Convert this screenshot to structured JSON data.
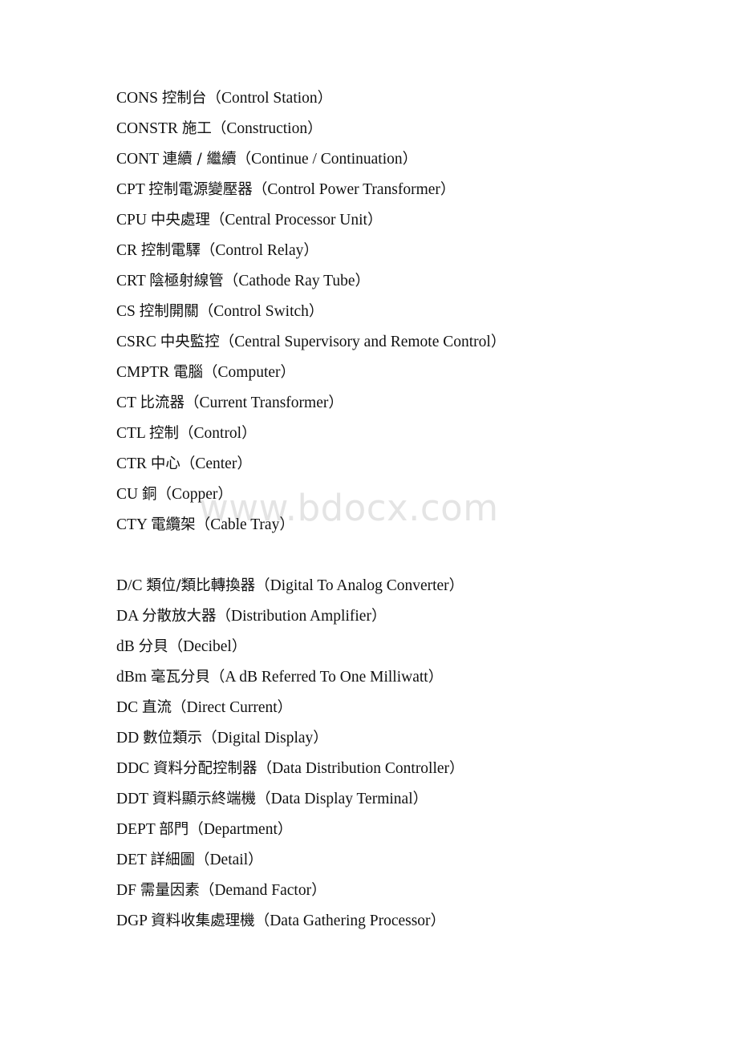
{
  "document": {
    "type": "glossary-page",
    "background_color": "#ffffff",
    "text_color": "#111111"
  },
  "watermark": {
    "text": "www.bdocx.com",
    "color": "#e4e4e4"
  },
  "entries": [
    {
      "abbr": "CONS",
      "cjk": "控制台",
      "en": "Control Station"
    },
    {
      "abbr": "CONSTR",
      "cjk": "施工",
      "en": "Construction"
    },
    {
      "abbr": "CONT",
      "cjk": "連續 / 繼續",
      "en": "Continue / Continuation"
    },
    {
      "abbr": "CPT",
      "cjk": "控制電源變壓器",
      "en": "Control Power Transformer"
    },
    {
      "abbr": "CPU",
      "cjk": "中央處理",
      "en": "Central Processor Unit"
    },
    {
      "abbr": "CR",
      "cjk": "控制電驛",
      "en": "Control Relay"
    },
    {
      "abbr": "CRT",
      "cjk": "陰極射線管",
      "en": "Cathode Ray Tube"
    },
    {
      "abbr": "CS",
      "cjk": "控制開關",
      "en": "Control Switch"
    },
    {
      "abbr": "CSRC",
      "cjk": "中央監控",
      "en": "Central Supervisory and Remote Control"
    },
    {
      "abbr": "CMPTR",
      "cjk": "電腦",
      "en": "Computer"
    },
    {
      "abbr": "CT",
      "cjk": "比流器",
      "en": "Current Transformer"
    },
    {
      "abbr": "CTL",
      "cjk": "控制",
      "en": "Control"
    },
    {
      "abbr": "CTR",
      "cjk": "中心",
      "en": "Center"
    },
    {
      "abbr": "CU",
      "cjk": "銅",
      "en": "Copper"
    },
    {
      "abbr": "CTY",
      "cjk": "電纜架",
      "en": "Cable Tray"
    },
    {
      "spacer": true
    },
    {
      "abbr": "D/C",
      "cjk": "類位/類比轉換器",
      "en": "Digital To Analog Converter"
    },
    {
      "abbr": "DA",
      "cjk": "分散放大器",
      "en": "Distribution Amplifier"
    },
    {
      "abbr": "dB",
      "cjk": "分貝",
      "en": "Decibel"
    },
    {
      "abbr": "dBm",
      "cjk": "毫瓦分貝",
      "en": "A dB Referred To One Milliwatt"
    },
    {
      "abbr": "DC",
      "cjk": "直流",
      "en": "Direct Current"
    },
    {
      "abbr": "DD",
      "cjk": "數位類示",
      "en": "Digital Display"
    },
    {
      "abbr": "DDC",
      "cjk": "資料分配控制器",
      "en": "Data Distribution Controller"
    },
    {
      "abbr": "DDT",
      "cjk": "資料顯示終端機",
      "en": "Data Display Terminal"
    },
    {
      "abbr": "DEPT",
      "cjk": "部門",
      "en": "Department"
    },
    {
      "abbr": "DET",
      "cjk": "詳細圖",
      "en": "Detail"
    },
    {
      "abbr": "DF",
      "cjk": "需量因素",
      "en": "Demand Factor"
    },
    {
      "abbr": "DGP",
      "cjk": "資料收集處理機",
      "en": "Data Gathering Processor"
    }
  ]
}
